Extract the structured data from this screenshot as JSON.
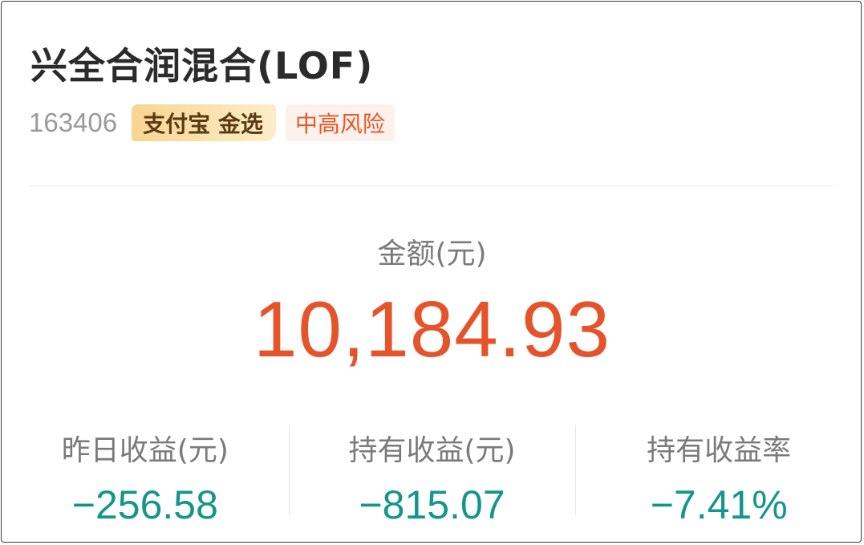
{
  "fund": {
    "name": "兴全合润混合(LOF)",
    "code": "163406",
    "badge_platform": "支付宝 金选",
    "risk_level": "中高风险"
  },
  "amount": {
    "label": "金额(元)",
    "value": "10,184.93"
  },
  "stats": [
    {
      "label": "昨日收益(元)",
      "value": "−256.58"
    },
    {
      "label": "持有收益(元)",
      "value": "−815.07"
    },
    {
      "label": "持有收益率",
      "value": "−7.41%"
    }
  ],
  "colors": {
    "amount": "#e5532a",
    "loss": "#14968a",
    "risk": "#e8582a",
    "badge_gold": "#f7d590"
  }
}
